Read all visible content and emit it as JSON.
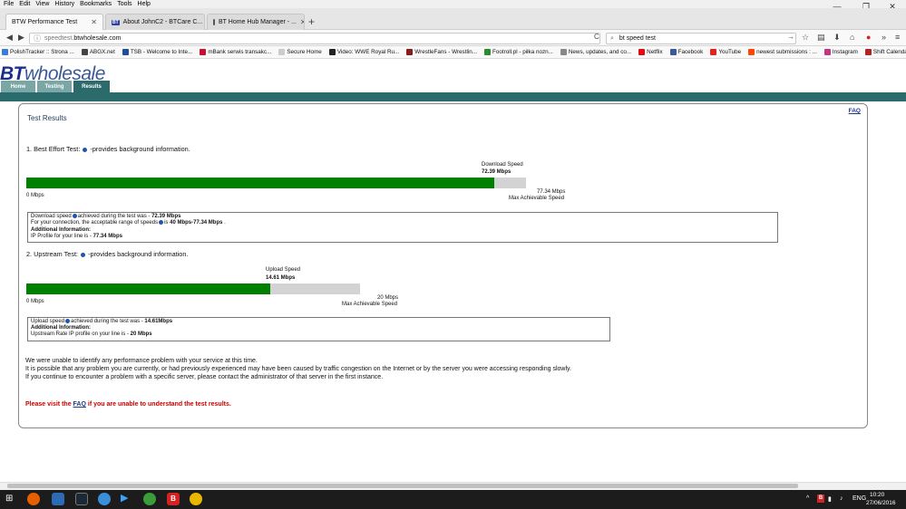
{
  "menu": [
    "File",
    "Edit",
    "View",
    "History",
    "Bookmarks",
    "Tools",
    "Help"
  ],
  "window_controls": {
    "minimize": "—",
    "restore": "❐",
    "close": "✕"
  },
  "tabs": [
    {
      "title": "BTW Performance Test",
      "active": true
    },
    {
      "title": "About JohnC2 - BTCare C...",
      "favicon": "BT",
      "active": false
    },
    {
      "title": "BT Home Hub Manager - ...",
      "active": false
    }
  ],
  "new_tab": "+",
  "nav": {
    "url_dim": "speedtest.",
    "url_main": "btwholesale.com",
    "search_value": "bt speed test",
    "back": "◀",
    "forward": "▶",
    "reload": "C"
  },
  "bookmarks": [
    {
      "label": "PolishTracker :: Strona ...",
      "color": "#3a7bd5"
    },
    {
      "label": "ABGX.net",
      "color": "#444444"
    },
    {
      "label": "TSB - Welcome to Inte...",
      "color": "#1f4e9c"
    },
    {
      "label": "mBank serwis transakc...",
      "color": "#c8102e"
    },
    {
      "label": "Secure Home",
      "color": "#cccccc"
    },
    {
      "label": "Video: WWE Royal Ru...",
      "color": "#222222"
    },
    {
      "label": "WrestleFans - Wrestlin...",
      "color": "#8b1a1a"
    },
    {
      "label": "Footroll.pl - piłka nozn...",
      "color": "#2b8a2b"
    },
    {
      "label": "News, updates, and co...",
      "color": "#888888"
    },
    {
      "label": "Netflix",
      "color": "#e50914"
    },
    {
      "label": "Facebook",
      "color": "#3b5998"
    },
    {
      "label": "YouTube",
      "color": "#e62117"
    },
    {
      "label": "newest submissions : ...",
      "color": "#ff4500"
    },
    {
      "label": "Instagram",
      "color": "#c13584"
    },
    {
      "label": "Shift Calendar-Firefigh...",
      "color": "#b22222"
    }
  ],
  "bt": {
    "logo_bt": "BT",
    "logo_word": "wholesale",
    "nav_tabs": [
      "Home",
      "Testing",
      "Results"
    ]
  },
  "page": {
    "heading": "Test Results",
    "faq_link": "FAQ",
    "section1_title": "1. Best Effort Test:",
    "section1_suffix": "-provides background information.",
    "download_label": "Download Speed",
    "download_value": "72.39 Mbps",
    "download_fraction": 0.9359,
    "download_min": "0 Mbps",
    "download_max": "77.34 Mbps",
    "max_label": "Max Achievable Speed",
    "box1_line1_a": "Download speed",
    "box1_line1_b": "achieved during the test was -",
    "box1_line1_val": "72.39 Mbps",
    "box1_line2_a": "For your connection, the acceptable range of speeds",
    "box1_line2_b": "is",
    "box1_line2_val": "40 Mbps-77.34 Mbps",
    "box1_line2_end": ".",
    "box1_line3": "Additional Information:",
    "box1_line4_a": "IP Profile for your line is -",
    "box1_line4_val": "77.34 Mbps",
    "section2_title": "2. Upstream Test:",
    "section2_suffix": "-provides background information.",
    "upload_label": "Upload Speed",
    "upload_value": "14.61 Mbps",
    "upload_fraction": 0.7305,
    "upload_min": "0 Mbps",
    "upload_max": "20 Mbps",
    "box2_line1_a": "Upload speed",
    "box2_line1_b": "achieved during the test was -",
    "box2_line1_val": "14.61Mbps",
    "box2_line2": "Additional Information:",
    "box2_line3_a": "Upstream Rate IP profile on your line is -",
    "box2_line3_val": "20 Mbps",
    "para1": "We were unable to identify any performance problem with your service at this time.",
    "para2": "It is possible that any problem you are currently, or had previously experienced may have been caused by traffic congestion on the Internet or by the server you were accessing responding slowly.",
    "para3": "If you continue to encounter a problem with a specific server, please contact the administrator of that server in the first instance.",
    "visit_a": "Please visit the",
    "visit_link": "FAQ",
    "visit_b": "if you are unable to understand the test results."
  },
  "taskbar": {
    "lang": "ENG",
    "time": "10:20",
    "date": "27/06/2016",
    "tray_arrow": "^"
  },
  "colors": {
    "bar_fill": "#008000",
    "bar_bg": "#d3d3d3",
    "bt_teal": "#2b6b6b",
    "warn_red": "#cc0000"
  }
}
